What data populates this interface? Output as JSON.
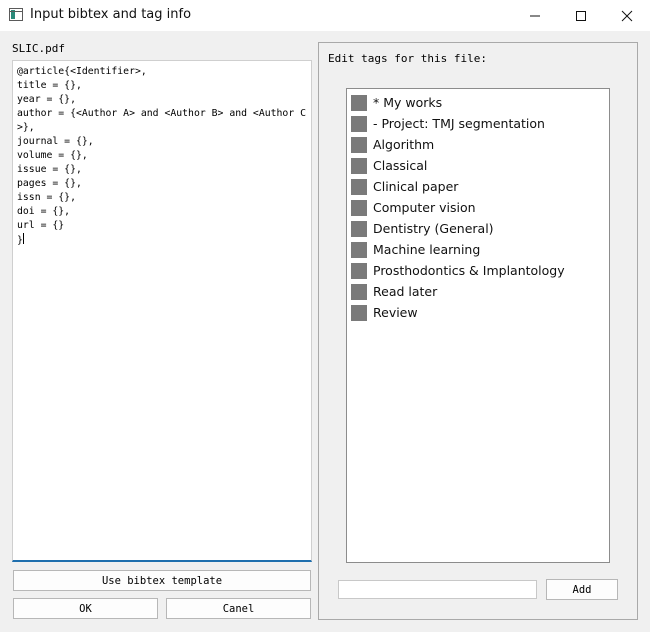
{
  "window": {
    "title": "Input bibtex and tag info",
    "controls": {
      "minimize": "minimize-icon",
      "maximize": "maximize-icon",
      "close": "close-icon"
    }
  },
  "left_panel": {
    "file_name": "SLIC.pdf",
    "bibtex_text": "@article{<Identifier>,\ntitle = {},\nyear = {},\nauthor = {<Author A> and <Author B> and <Author C>},\njournal = {},\nvolume = {},\nissue = {},\npages = {},\nissn = {},\ndoi = {},\nurl = {}\n}",
    "template_button": "Use bibtex template",
    "ok_button": "OK",
    "cancel_button": "Canel"
  },
  "right_panel": {
    "group_title": "Edit tags for this file:",
    "tags": [
      {
        "label": "* My works",
        "checked": false
      },
      {
        "label": "- Project: TMJ segmentation",
        "checked": false
      },
      {
        "label": "Algorithm",
        "checked": false
      },
      {
        "label": "Classical",
        "checked": false
      },
      {
        "label": "Clinical paper",
        "checked": false
      },
      {
        "label": "Computer vision",
        "checked": false
      },
      {
        "label": "Dentistry (General)",
        "checked": false
      },
      {
        "label": "Machine learning",
        "checked": false
      },
      {
        "label": "Prosthodontics & Implantology",
        "checked": false
      },
      {
        "label": "Read later",
        "checked": false
      },
      {
        "label": "Review",
        "checked": false
      }
    ],
    "new_tag_value": "",
    "add_button": "Add"
  },
  "colors": {
    "editor_focus_border": "#1f6fae",
    "checkbox_fill": "#7a7a7a",
    "window_background": "#f0f0f0"
  }
}
